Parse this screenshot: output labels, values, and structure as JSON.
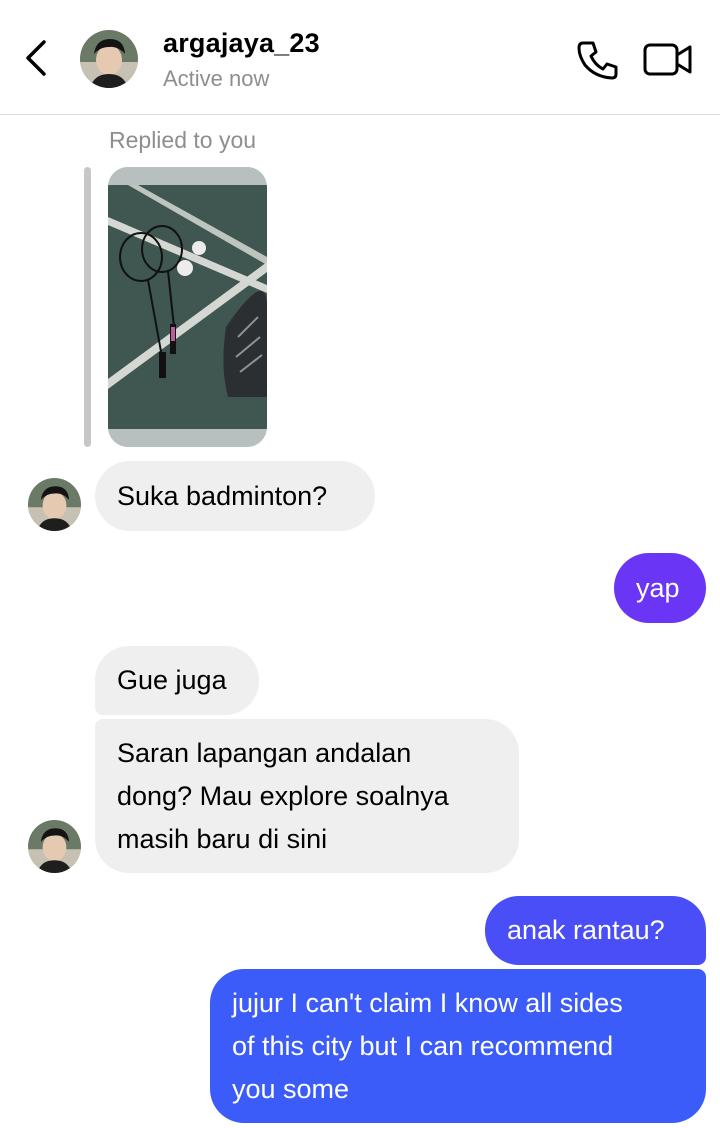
{
  "header": {
    "username": "argajaya_23",
    "status": "Active now"
  },
  "thread": {
    "replied_label": "Replied to you",
    "messages": [
      {
        "from": "them",
        "text": "Suka badminton?"
      },
      {
        "from": "me",
        "text": "yap"
      },
      {
        "from": "them",
        "text": "Gue juga"
      },
      {
        "from": "them",
        "lines": [
          "Saran lapangan andalan",
          "dong? Mau explore soalnya",
          "masih baru di sini"
        ]
      },
      {
        "from": "me",
        "text": "anak rantau?"
      },
      {
        "from": "me",
        "lines": [
          "jujur I can't claim I know all sides",
          "of this city but I can recommend",
          "you some"
        ]
      }
    ]
  },
  "colors": {
    "incoming_bubble": "#efefef",
    "outgoing_purple": "#6a35f5",
    "outgoing_blue": "#3b5cf8",
    "secondary_text": "#8e8e8e"
  },
  "icons": [
    "back-chevron-icon",
    "phone-icon",
    "video-camera-icon"
  ]
}
